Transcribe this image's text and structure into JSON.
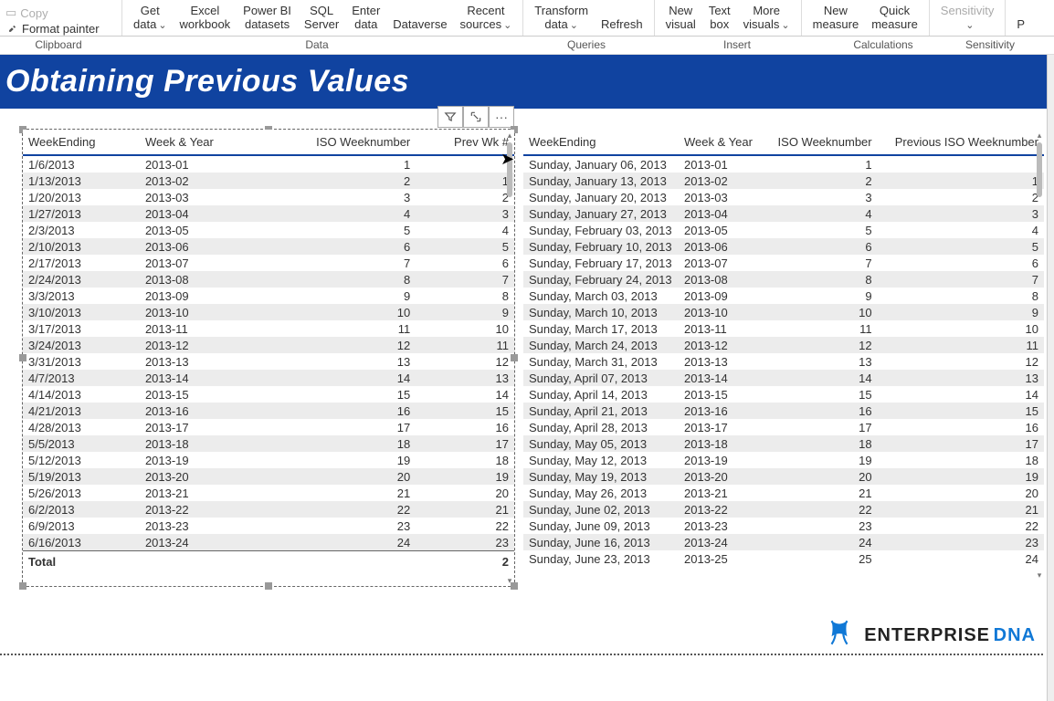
{
  "ribbon": {
    "clipboard_group": "Clipboard",
    "data_group": "Data",
    "queries_group": "Queries",
    "insert_group": "Insert",
    "calc_group": "Calculations",
    "sens_group": "Sensitivity",
    "format_painter": "Format painter",
    "copy": "Copy",
    "get_data": {
      "l1": "Get",
      "l2": "data"
    },
    "excel": {
      "l1": "Excel",
      "l2": "workbook"
    },
    "pbi": {
      "l1": "Power BI",
      "l2": "datasets"
    },
    "sql": {
      "l1": "SQL",
      "l2": "Server"
    },
    "enter": {
      "l1": "Enter",
      "l2": "data"
    },
    "dataverse": {
      "l1": "Dataverse",
      "l2": ""
    },
    "recent": {
      "l1": "Recent",
      "l2": "sources"
    },
    "transform": {
      "l1": "Transform",
      "l2": "data"
    },
    "refresh": {
      "l1": "Refresh",
      "l2": ""
    },
    "newvisual": {
      "l1": "New",
      "l2": "visual"
    },
    "textbox": {
      "l1": "Text",
      "l2": "box"
    },
    "morevisuals": {
      "l1": "More",
      "l2": "visuals"
    },
    "newmeasure": {
      "l1": "New",
      "l2": "measure"
    },
    "quickmeasure": {
      "l1": "Quick",
      "l2": "measure"
    },
    "sensitivity": {
      "l1": "Sensitivity",
      "l2": ""
    },
    "pstub": "P"
  },
  "title": "Obtaining Previous Values",
  "logo": {
    "brand1": "ENTERPRISE",
    "brand2": "DNA"
  },
  "tableLeft": {
    "headers": [
      "WeekEnding",
      "Week & Year",
      "ISO Weeknumber",
      "Prev Wk #"
    ],
    "total_label": "Total",
    "total_prev": "2",
    "rows": [
      [
        "1/6/2013",
        "2013-01",
        "1",
        ""
      ],
      [
        "1/13/2013",
        "2013-02",
        "2",
        "1"
      ],
      [
        "1/20/2013",
        "2013-03",
        "3",
        "2"
      ],
      [
        "1/27/2013",
        "2013-04",
        "4",
        "3"
      ],
      [
        "2/3/2013",
        "2013-05",
        "5",
        "4"
      ],
      [
        "2/10/2013",
        "2013-06",
        "6",
        "5"
      ],
      [
        "2/17/2013",
        "2013-07",
        "7",
        "6"
      ],
      [
        "2/24/2013",
        "2013-08",
        "8",
        "7"
      ],
      [
        "3/3/2013",
        "2013-09",
        "9",
        "8"
      ],
      [
        "3/10/2013",
        "2013-10",
        "10",
        "9"
      ],
      [
        "3/17/2013",
        "2013-11",
        "11",
        "10"
      ],
      [
        "3/24/2013",
        "2013-12",
        "12",
        "11"
      ],
      [
        "3/31/2013",
        "2013-13",
        "13",
        "12"
      ],
      [
        "4/7/2013",
        "2013-14",
        "14",
        "13"
      ],
      [
        "4/14/2013",
        "2013-15",
        "15",
        "14"
      ],
      [
        "4/21/2013",
        "2013-16",
        "16",
        "15"
      ],
      [
        "4/28/2013",
        "2013-17",
        "17",
        "16"
      ],
      [
        "5/5/2013",
        "2013-18",
        "18",
        "17"
      ],
      [
        "5/12/2013",
        "2013-19",
        "19",
        "18"
      ],
      [
        "5/19/2013",
        "2013-20",
        "20",
        "19"
      ],
      [
        "5/26/2013",
        "2013-21",
        "21",
        "20"
      ],
      [
        "6/2/2013",
        "2013-22",
        "22",
        "21"
      ],
      [
        "6/9/2013",
        "2013-23",
        "23",
        "22"
      ],
      [
        "6/16/2013",
        "2013-24",
        "24",
        "23"
      ]
    ]
  },
  "tableRight": {
    "headers": [
      "WeekEnding",
      "Week & Year",
      "ISO Weeknumber",
      "Previous ISO Weeknumber"
    ],
    "rows": [
      [
        "Sunday, January 06, 2013",
        "2013-01",
        "1",
        ""
      ],
      [
        "Sunday, January 13, 2013",
        "2013-02",
        "2",
        "1"
      ],
      [
        "Sunday, January 20, 2013",
        "2013-03",
        "3",
        "2"
      ],
      [
        "Sunday, January 27, 2013",
        "2013-04",
        "4",
        "3"
      ],
      [
        "Sunday, February 03, 2013",
        "2013-05",
        "5",
        "4"
      ],
      [
        "Sunday, February 10, 2013",
        "2013-06",
        "6",
        "5"
      ],
      [
        "Sunday, February 17, 2013",
        "2013-07",
        "7",
        "6"
      ],
      [
        "Sunday, February 24, 2013",
        "2013-08",
        "8",
        "7"
      ],
      [
        "Sunday, March 03, 2013",
        "2013-09",
        "9",
        "8"
      ],
      [
        "Sunday, March 10, 2013",
        "2013-10",
        "10",
        "9"
      ],
      [
        "Sunday, March 17, 2013",
        "2013-11",
        "11",
        "10"
      ],
      [
        "Sunday, March 24, 2013",
        "2013-12",
        "12",
        "11"
      ],
      [
        "Sunday, March 31, 2013",
        "2013-13",
        "13",
        "12"
      ],
      [
        "Sunday, April 07, 2013",
        "2013-14",
        "14",
        "13"
      ],
      [
        "Sunday, April 14, 2013",
        "2013-15",
        "15",
        "14"
      ],
      [
        "Sunday, April 21, 2013",
        "2013-16",
        "16",
        "15"
      ],
      [
        "Sunday, April 28, 2013",
        "2013-17",
        "17",
        "16"
      ],
      [
        "Sunday, May 05, 2013",
        "2013-18",
        "18",
        "17"
      ],
      [
        "Sunday, May 12, 2013",
        "2013-19",
        "19",
        "18"
      ],
      [
        "Sunday, May 19, 2013",
        "2013-20",
        "20",
        "19"
      ],
      [
        "Sunday, May 26, 2013",
        "2013-21",
        "21",
        "20"
      ],
      [
        "Sunday, June 02, 2013",
        "2013-22",
        "22",
        "21"
      ],
      [
        "Sunday, June 09, 2013",
        "2013-23",
        "23",
        "22"
      ],
      [
        "Sunday, June 16, 2013",
        "2013-24",
        "24",
        "23"
      ],
      [
        "Sunday, June 23, 2013",
        "2013-25",
        "25",
        "24"
      ]
    ]
  }
}
